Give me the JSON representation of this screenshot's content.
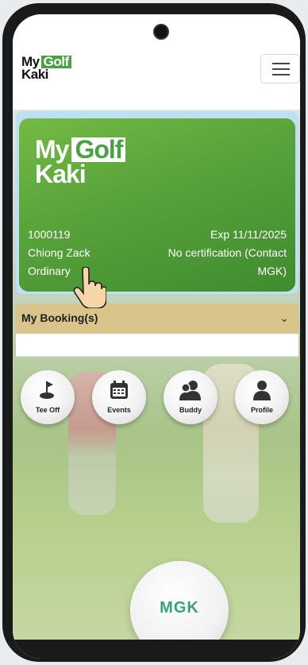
{
  "header": {
    "logo_line1": "My",
    "logo_golf": "Golf",
    "logo_line2": "Kaki"
  },
  "card": {
    "logo_line1": "My",
    "logo_golf": "Golf",
    "logo_line2": "Kaki",
    "member_id": "1000119",
    "expiry": "Exp 11/11/2025",
    "name": "Chiong Zack",
    "certification_line1": "No certification (Contact",
    "membership_type": "Ordinary",
    "certification_line2": "MGK)"
  },
  "booking": {
    "label": "My Booking(s)",
    "chevron_icon": "chevron-down-icon"
  },
  "quick_actions": [
    {
      "label": "Tee Off",
      "icon": "golf-flag-icon"
    },
    {
      "label": "Events",
      "icon": "calendar-icon"
    },
    {
      "label": "Buddy",
      "icon": "users-icon"
    },
    {
      "label": "Profile",
      "icon": "user-icon"
    }
  ],
  "ball_text": "MGK",
  "colors": {
    "brand_green": "#4aa142",
    "booking_bar": "#d9c48c"
  }
}
